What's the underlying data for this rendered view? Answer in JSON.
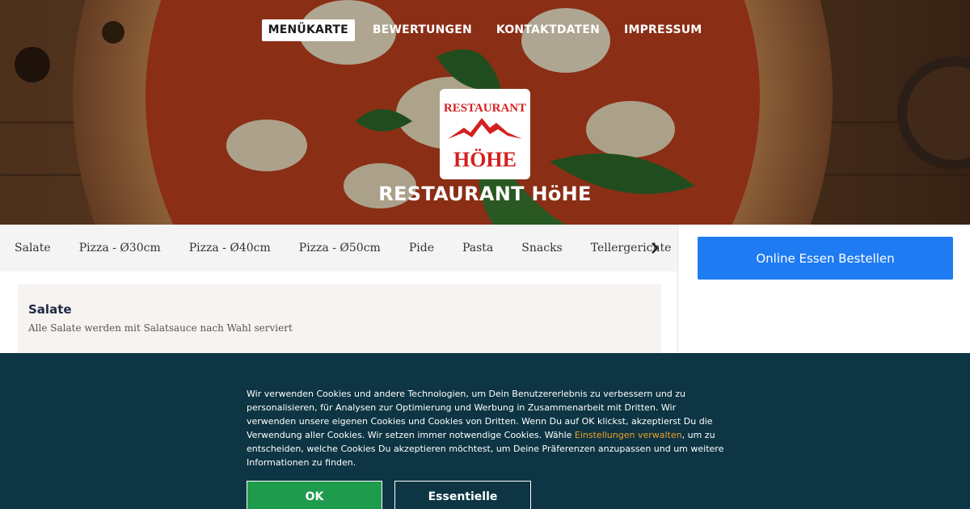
{
  "nav": {
    "items": [
      {
        "label": "MENÜKARTE",
        "active": true
      },
      {
        "label": "BEWERTUNGEN",
        "active": false
      },
      {
        "label": "KONTAKTDATEN",
        "active": false
      },
      {
        "label": "IMPRESSUM",
        "active": false
      }
    ]
  },
  "hero": {
    "logo_top": "RESTAURANT",
    "logo_bottom": "HÖHE",
    "title": "RESTAURANT HöHE"
  },
  "categories": [
    "Salate",
    "Pizza - Ø30cm",
    "Pizza - Ø40cm",
    "Pizza - Ø50cm",
    "Pide",
    "Pasta",
    "Snacks",
    "Tellergerichte"
  ],
  "sidebar": {
    "order_label": "Online Essen Bestellen"
  },
  "section": {
    "title": "Salate",
    "description": "Alle Salate werden mit Salatsauce nach Wahl serviert"
  },
  "cookie": {
    "text_before": "Wir verwenden Cookies und andere Technologien, um Dein Benutzererlebnis zu verbessern und zu personalisieren, für Analysen zur Optimierung und Werbung in Zusammenarbeit mit Dritten. Wir verwenden unsere eigenen Cookies und Cookies von Dritten. Wenn Du auf OK klickst, akzeptierst Du die Verwendung aller Cookies. Wir setzen immer notwendige Cookies. Wähle ",
    "link": "Einstellungen verwalten",
    "text_after": ", um zu entscheiden, welche Cookies Du akzeptieren möchtest, um Deine Präferenzen anzupassen und um weitere Informationen zu finden.",
    "ok_label": "OK",
    "essential_label": "Essentielle"
  },
  "colors": {
    "accent_blue": "#1e7bf2",
    "cookie_bg": "#0d3543",
    "ok_green": "#1f9b4e",
    "link_orange": "#f0a02a",
    "logo_red": "#d42020"
  }
}
